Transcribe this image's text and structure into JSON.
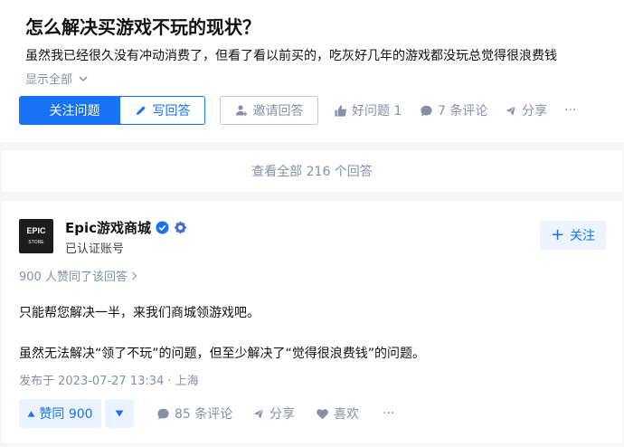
{
  "question": {
    "title": "怎么解决买游戏不玩的现状？",
    "excerpt": "虽然我已经很久没有冲动消费了，但看了看以前买的，吃灰好几年的游戏都没玩总觉得很浪费钱",
    "show_all": "显示全部",
    "follow_label": "关注问题",
    "write_label": "写回答",
    "invite_label": "邀请回答",
    "good_question_label": "好问题 1",
    "comments_label": "7 条评论",
    "share_label": "分享",
    "more_label": "···"
  },
  "view_all_label": "查看全部 216 个回答",
  "answer": {
    "avatar_top": "EPIC",
    "avatar_bottom": "STORE",
    "author_name": "Epic游戏商城",
    "author_sub": "已认证账号",
    "follow_label": "关注",
    "upvoted_text": "900 人赞同了该回答",
    "paragraph1": "只能帮您解决一半，来我们商城领游戏吧。",
    "paragraph2": "虽然无法解决“领了不玩”的问题，但至少解决了“觉得很浪费钱”的问题。",
    "published": "发布于 2023-07-27 13:34 · 上海",
    "vote_label": "赞同 900",
    "comments_label": "85 条评论",
    "share_label": "分享",
    "like_label": "喜欢",
    "more_label": "···"
  },
  "colors": {
    "accent": "#1772f6",
    "accent_light": "#ebf4fe",
    "muted": "#8590a6",
    "background": "#f6f6f6"
  }
}
